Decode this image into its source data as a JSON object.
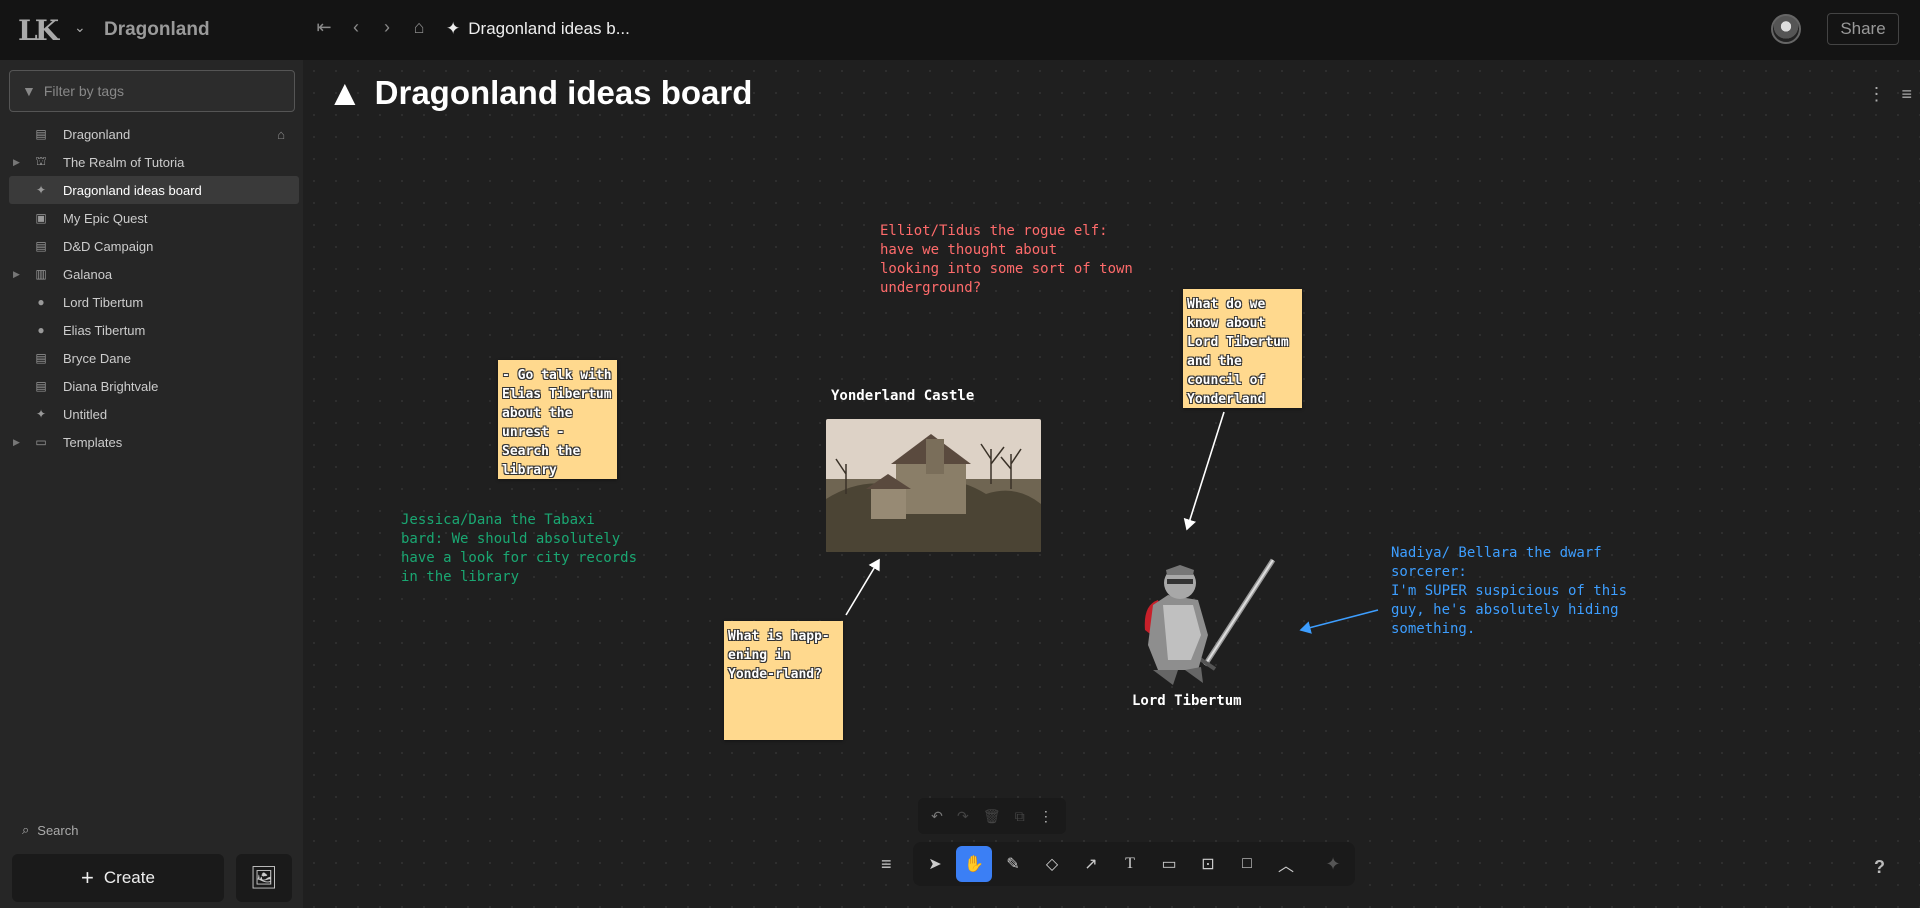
{
  "header": {
    "logo_text": "LK",
    "world_name": "Dragonland",
    "breadcrumb": "Dragonland ideas b...",
    "share_label": "Share"
  },
  "sidebar": {
    "filter_placeholder": "Filter by tags",
    "items": [
      {
        "label": "Dragonland",
        "icon": "page-icon",
        "expandable": false,
        "home": true
      },
      {
        "label": "The Realm of Tutoria",
        "icon": "realm-icon",
        "expandable": true
      },
      {
        "label": "Dragonland ideas board",
        "icon": "whiteboard-icon",
        "expandable": false,
        "active": true
      },
      {
        "label": "My Epic Quest",
        "icon": "quest-icon",
        "expandable": false
      },
      {
        "label": "D&D Campaign",
        "icon": "page-icon",
        "expandable": false
      },
      {
        "label": "Galanoa",
        "icon": "map-icon",
        "expandable": true
      },
      {
        "label": "Lord Tibertum",
        "icon": "person-icon",
        "expandable": false
      },
      {
        "label": "Elias Tibertum",
        "icon": "person-icon",
        "expandable": false
      },
      {
        "label": "Bryce Dane",
        "icon": "page-icon",
        "expandable": false
      },
      {
        "label": "Diana Brightvale",
        "icon": "page-icon",
        "expandable": false
      },
      {
        "label": "Untitled",
        "icon": "whiteboard-icon",
        "expandable": false
      },
      {
        "label": "Templates",
        "icon": "folder-icon",
        "expandable": true
      }
    ],
    "search_label": "Search",
    "create_label": "Create"
  },
  "board": {
    "title": "Dragonland ideas board",
    "stickies": {
      "go_talk": "- Go talk with Elias Tibertum about the unrest\n- Search the library",
      "what_know": "What do we know about Lord Tibertum and the council of Yonderland",
      "happening": "What is happ-ening in Yonde-rland?"
    },
    "notes": {
      "elliot": "Elliot/Tidus the rogue elf:\nhave we thought about\nlooking into some sort of town\nunderground?",
      "jessica": "Jessica/Dana the Tabaxi\nbard: We should absolutely\nhave a look for city records\nin the library",
      "nadiya": "Nadiya/ Bellara the dwarf\nsorcerer:\nI'm SUPER suspicious of this\nguy, he's absolutely hiding\nsomething."
    },
    "image_labels": {
      "castle": "Yonderland Castle",
      "knight": "Lord Tibertum"
    },
    "colors": {
      "sticky": "#ffd98e",
      "elliot_note": "#ff6b6b",
      "jessica_note": "#1aa772",
      "nadiya_note": "#3d9eff",
      "active_tool": "#3b7ff5"
    }
  },
  "toolbar": {
    "tools": [
      "select-icon",
      "hand-icon",
      "pencil-icon",
      "eraser-icon",
      "arrow-icon",
      "text-icon",
      "sticky-note-icon",
      "image-icon",
      "rectangle-icon",
      "chevron-up-icon"
    ],
    "active_tool": "hand-icon",
    "help_label": "?"
  }
}
